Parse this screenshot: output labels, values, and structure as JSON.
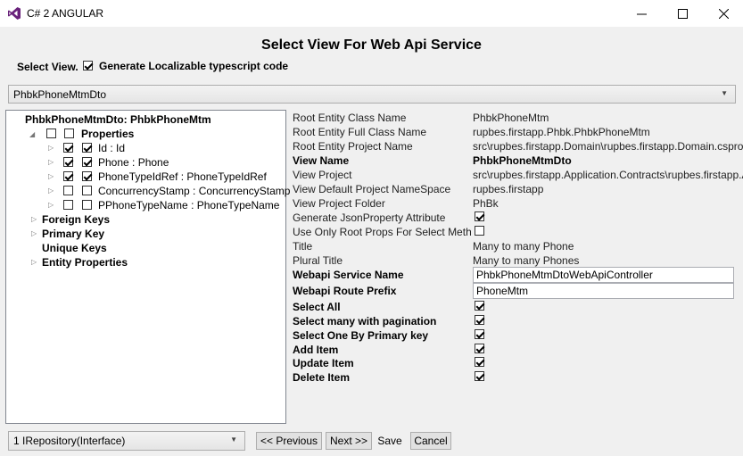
{
  "window": {
    "title": "C# 2 ANGULAR",
    "minimize_icon": "minimize-icon",
    "maximize_icon": "maximize-icon",
    "close_icon": "close-icon"
  },
  "dialog_title": "Select View For Web Api Service",
  "select_view_label": "Select View.",
  "localizable_checkbox": {
    "label": "Generate Localizable typescript code",
    "checked": true
  },
  "view_combo": {
    "value": "PhbkPhoneMtmDto"
  },
  "tree": {
    "root": "PhbkPhoneMtmDto: PhbkPhoneMtm",
    "properties_label": "Properties",
    "properties": [
      {
        "label": "Id : Id",
        "checked1": true,
        "checked2": true
      },
      {
        "label": "Phone : Phone",
        "checked1": true,
        "checked2": true
      },
      {
        "label": "PhoneTypeIdRef : PhoneTypeIdRef",
        "checked1": true,
        "checked2": true
      },
      {
        "label": "ConcurrencyStamp : ConcurrencyStamp",
        "checked1": false,
        "checked2": false
      },
      {
        "label": "PPhoneTypeName : PhoneTypeName",
        "checked1": false,
        "checked2": false
      }
    ],
    "foreign_keys": "Foreign Keys",
    "primary_key": "Primary Key",
    "unique_keys": "Unique Keys",
    "entity_properties": "Entity Properties"
  },
  "props": {
    "root_entity_class_name": {
      "label": "Root Entity Class Name",
      "value": "PhbkPhoneMtm"
    },
    "root_entity_full_class_name": {
      "label": "Root Entity Full Class Name",
      "value": "rupbes.firstapp.Phbk.PhbkPhoneMtm"
    },
    "root_entity_project_name": {
      "label": "Root Entity Project Name",
      "value": "src\\rupbes.firstapp.Domain\\rupbes.firstapp.Domain.csproj"
    },
    "view_name": {
      "label": "View Name",
      "value": "PhbkPhoneMtmDto"
    },
    "view_project": {
      "label": "View Project",
      "value": "src\\rupbes.firstapp.Application.Contracts\\rupbes.firstapp.Application.Contracts.csproj"
    },
    "view_default_namespace": {
      "label": "View Default Project NameSpace",
      "value": "rupbes.firstapp"
    },
    "view_project_folder": {
      "label": "View Project Folder",
      "value": "PhBk"
    },
    "generate_json_property": {
      "label": "Generate JsonProperty Attribute",
      "checked": true
    },
    "use_only_root_props": {
      "label": "Use Only Root Props For Select Method",
      "checked": false
    },
    "title": {
      "label": "Title",
      "value": "Many to many Phone"
    },
    "plural_title": {
      "label": "Plural Title",
      "value": "Many to many Phones"
    },
    "webapi_service_name": {
      "label": "Webapi Service Name",
      "value": "PhbkPhoneMtmDtoWebApiController"
    },
    "webapi_route_prefix": {
      "label": "Webapi Route Prefix",
      "value": "PhoneMtm"
    },
    "select_all": {
      "label": "Select All",
      "checked": true
    },
    "select_many_pagination": {
      "label": "Select many with pagination",
      "checked": true
    },
    "select_one_by_pk": {
      "label": "Select One By Primary key",
      "checked": true
    },
    "add_item": {
      "label": "Add Item",
      "checked": true
    },
    "update_item": {
      "label": "Update Item",
      "checked": true
    },
    "delete_item": {
      "label": "Delete Item",
      "checked": true
    }
  },
  "bottom": {
    "repository_combo": "1 IRepository(Interface)",
    "previous": "<< Previous",
    "next": "Next >>",
    "save": "Save",
    "cancel": "Cancel"
  }
}
